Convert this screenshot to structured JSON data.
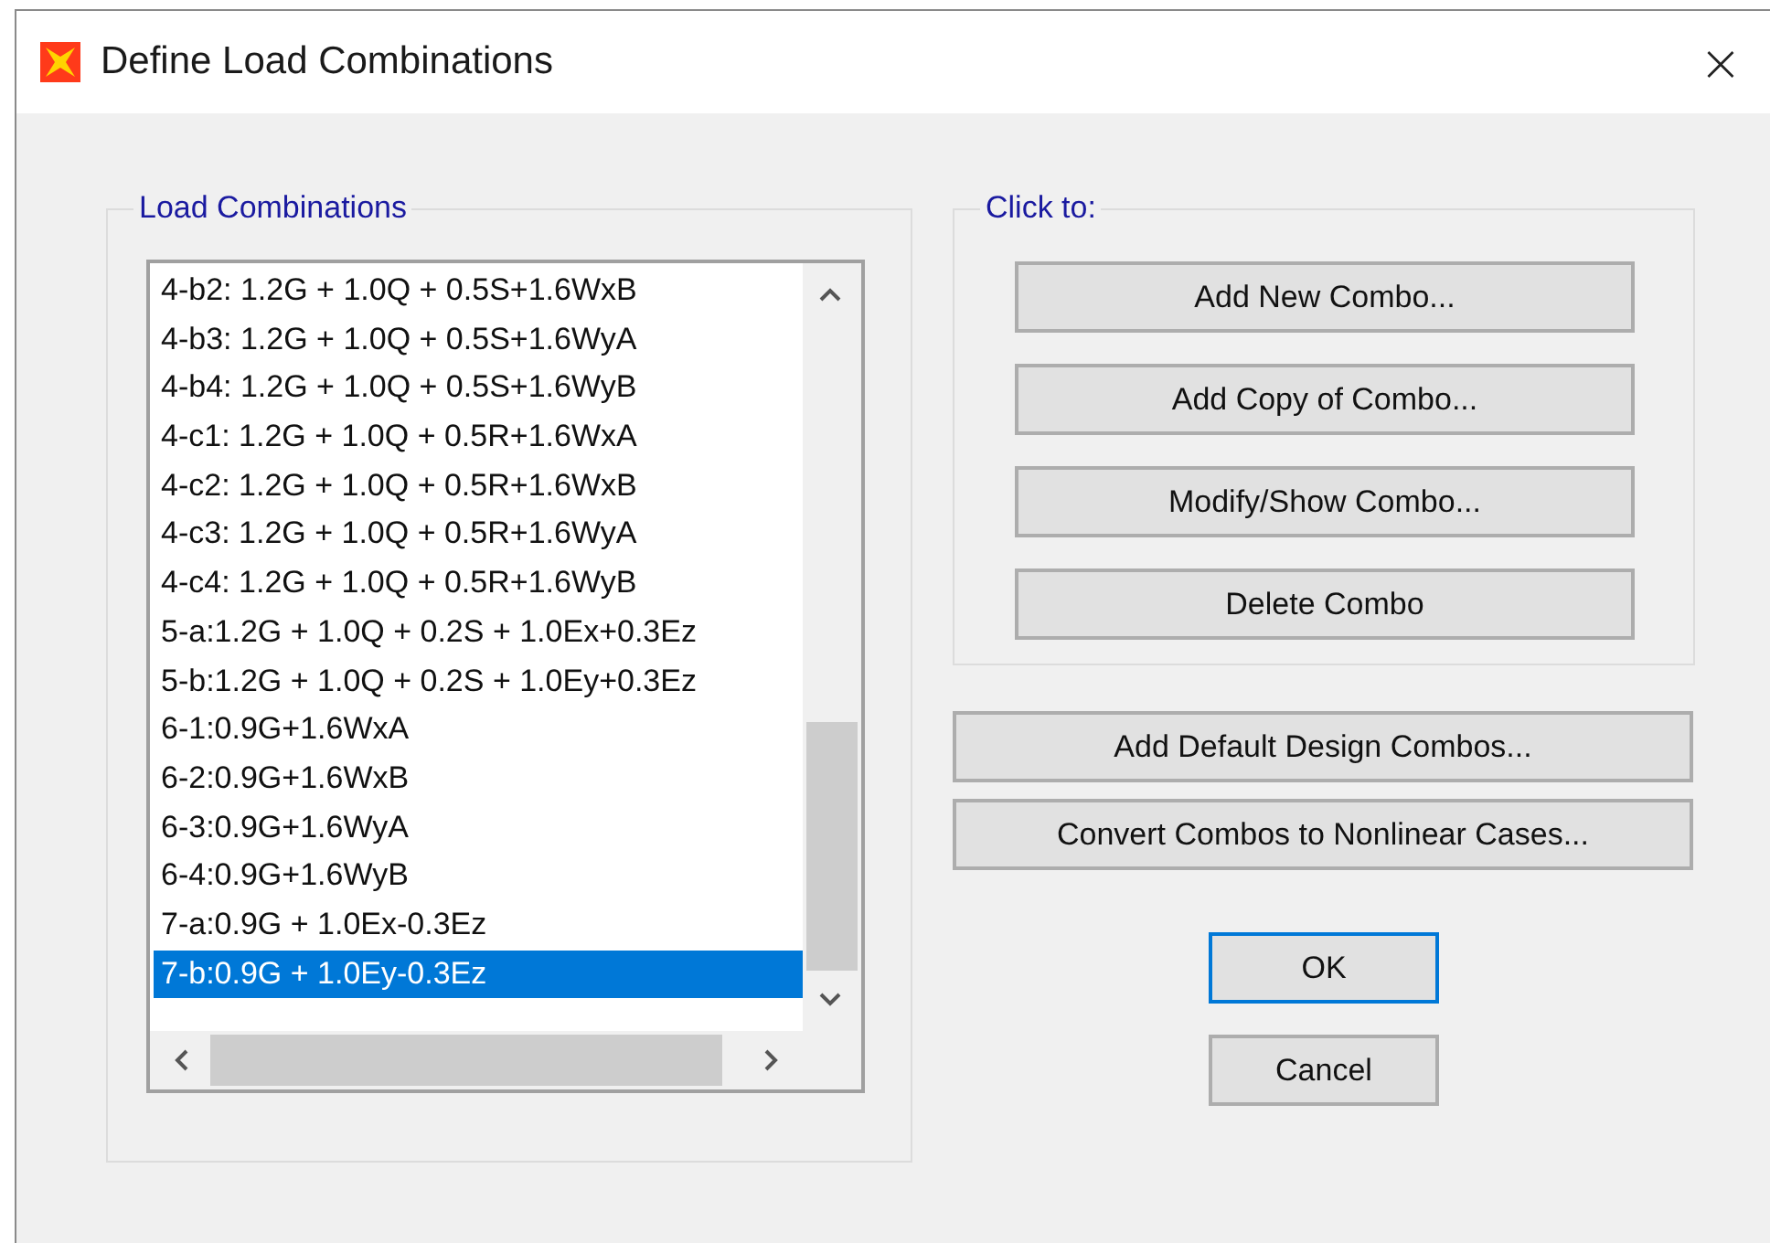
{
  "window": {
    "title": "Define Load Combinations",
    "close": "×"
  },
  "load_combinations": {
    "title": "Load Combinations",
    "items": [
      {
        "label": "4-b2: 1.2G + 1.0Q + 0.5S+1.6WxB",
        "selected": false
      },
      {
        "label": "4-b3: 1.2G + 1.0Q + 0.5S+1.6WyA",
        "selected": false
      },
      {
        "label": "4-b4: 1.2G + 1.0Q + 0.5S+1.6WyB",
        "selected": false
      },
      {
        "label": "4-c1: 1.2G + 1.0Q + 0.5R+1.6WxA",
        "selected": false
      },
      {
        "label": "4-c2: 1.2G + 1.0Q + 0.5R+1.6WxB",
        "selected": false
      },
      {
        "label": "4-c3: 1.2G + 1.0Q + 0.5R+1.6WyA",
        "selected": false
      },
      {
        "label": "4-c4: 1.2G + 1.0Q + 0.5R+1.6WyB",
        "selected": false
      },
      {
        "label": "5-a:1.2G + 1.0Q + 0.2S + 1.0Ex+0.3Ez",
        "selected": false
      },
      {
        "label": "5-b:1.2G + 1.0Q + 0.2S + 1.0Ey+0.3Ez",
        "selected": false
      },
      {
        "label": "6-1:0.9G+1.6WxA",
        "selected": false
      },
      {
        "label": "6-2:0.9G+1.6WxB",
        "selected": false
      },
      {
        "label": "6-3:0.9G+1.6WyA",
        "selected": false
      },
      {
        "label": "6-4:0.9G+1.6WyB",
        "selected": false
      },
      {
        "label": "7-a:0.9G + 1.0Ex-0.3Ez",
        "selected": false
      },
      {
        "label": "7-b:0.9G + 1.0Ey-0.3Ez",
        "selected": true
      }
    ]
  },
  "click_to": {
    "title": "Click to:",
    "buttons": [
      "Add New Combo...",
      "Add Copy of Combo...",
      "Modify/Show Combo...",
      "Delete Combo"
    ]
  },
  "extra_buttons": [
    "Add Default Design Combos...",
    "Convert Combos to Nonlinear Cases..."
  ],
  "dialog_buttons": [
    {
      "label": "OK",
      "default": true
    },
    {
      "label": "Cancel",
      "default": false
    }
  ]
}
